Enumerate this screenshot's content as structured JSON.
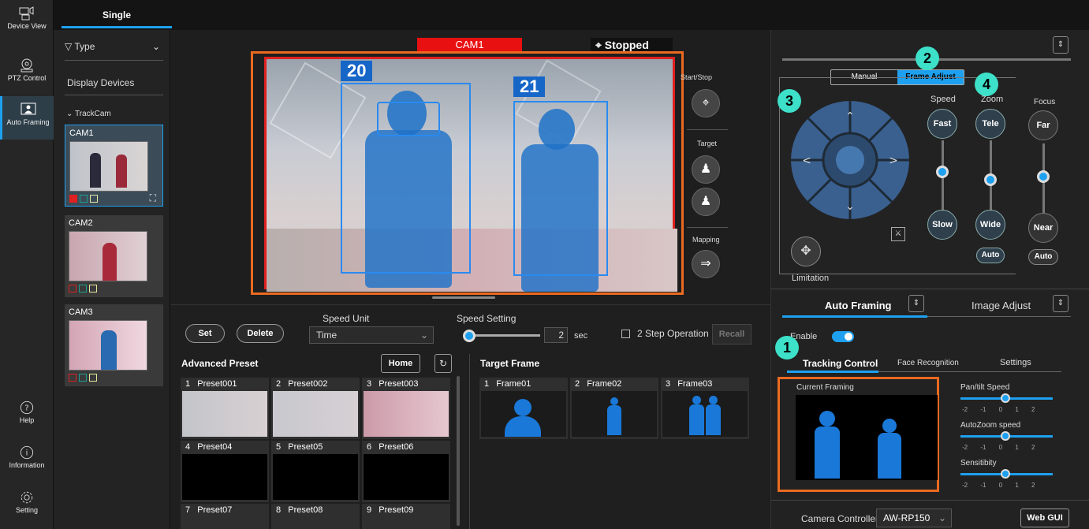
{
  "nav": {
    "items": [
      {
        "label": "Device View",
        "icon": "device-view-icon"
      },
      {
        "label": "PTZ Control",
        "icon": "ptz-control-icon"
      },
      {
        "label": "Auto Framing",
        "icon": "auto-framing-icon"
      },
      {
        "label": "Help",
        "icon": "help-icon"
      },
      {
        "label": "Information",
        "icon": "info-icon"
      },
      {
        "label": "Setting",
        "icon": "gear-icon"
      }
    ]
  },
  "tabs": {
    "single": "Single"
  },
  "devices": {
    "filter_label": "Type",
    "section_title": "Display Devices",
    "group_label": "TrackCam",
    "cams": [
      {
        "name": "CAM1"
      },
      {
        "name": "CAM2"
      },
      {
        "name": "CAM3"
      }
    ]
  },
  "preview": {
    "cam_label": "CAM1",
    "status": "Stopped",
    "targets": [
      "20",
      "21"
    ],
    "side": {
      "start_stop": "Start/Stop",
      "target": "Target",
      "mapping": "Mapping"
    }
  },
  "controls": {
    "set": "Set",
    "delete": "Delete",
    "speed_unit_label": "Speed Unit",
    "speed_unit_value": "Time",
    "speed_setting_label": "Speed Setting",
    "speed_value": "2",
    "speed_fraction": 0.0,
    "speed_unit_suffix": "sec",
    "two_step": "2 Step Operation",
    "recall": "Recall",
    "home": "Home"
  },
  "advanced_preset": {
    "title": "Advanced Preset",
    "items": [
      {
        "num": "1",
        "name": "Preset001"
      },
      {
        "num": "2",
        "name": "Preset002"
      },
      {
        "num": "3",
        "name": "Preset003"
      },
      {
        "num": "4",
        "name": "Preset04"
      },
      {
        "num": "5",
        "name": "Preset05"
      },
      {
        "num": "6",
        "name": "Preset06"
      },
      {
        "num": "7",
        "name": "Preset07"
      },
      {
        "num": "8",
        "name": "Preset08"
      },
      {
        "num": "9",
        "name": "Preset09"
      }
    ]
  },
  "target_frame": {
    "title": "Target Frame",
    "items": [
      {
        "num": "1",
        "name": "Frame01"
      },
      {
        "num": "2",
        "name": "Frame02"
      },
      {
        "num": "3",
        "name": "Frame03"
      }
    ]
  },
  "ptz": {
    "modes": [
      "Manual",
      "Frame Adjust"
    ],
    "speed_label": "Speed",
    "zoom_label": "Zoom",
    "focus_label": "Focus",
    "fast": "Fast",
    "slow": "Slow",
    "tele": "Tele",
    "wide": "Wide",
    "far": "Far",
    "near": "Near",
    "auto": "Auto",
    "limitation": "Limitation",
    "badges": [
      "1",
      "2",
      "3",
      "4"
    ]
  },
  "panel_tabs": {
    "auto_framing": "Auto Framing",
    "image_adjust": "Image Adjust"
  },
  "enable_label": "Enable",
  "sub_tabs": [
    "Tracking Control",
    "Face Recognition",
    "Settings"
  ],
  "tracking": {
    "current_framing": "Current Framing",
    "pan_tilt": "Pan/tilt Speed",
    "autozoom": "AutoZoom speed",
    "sensitivity": "Sensitibity",
    "scale": "-2 -1 0 1 2",
    "pan_tilt_value": 0,
    "autozoom_value": 0,
    "sensitivity_value": 0
  },
  "footer": {
    "camera_controller": "Camera Controller",
    "controller_value": "AW-RP150",
    "web_gui": "Web GUI"
  },
  "colors": {
    "accent": "#1ea0f0",
    "record": "#e02020",
    "frame": "#ea6a20",
    "badge": "#3de0c8"
  }
}
